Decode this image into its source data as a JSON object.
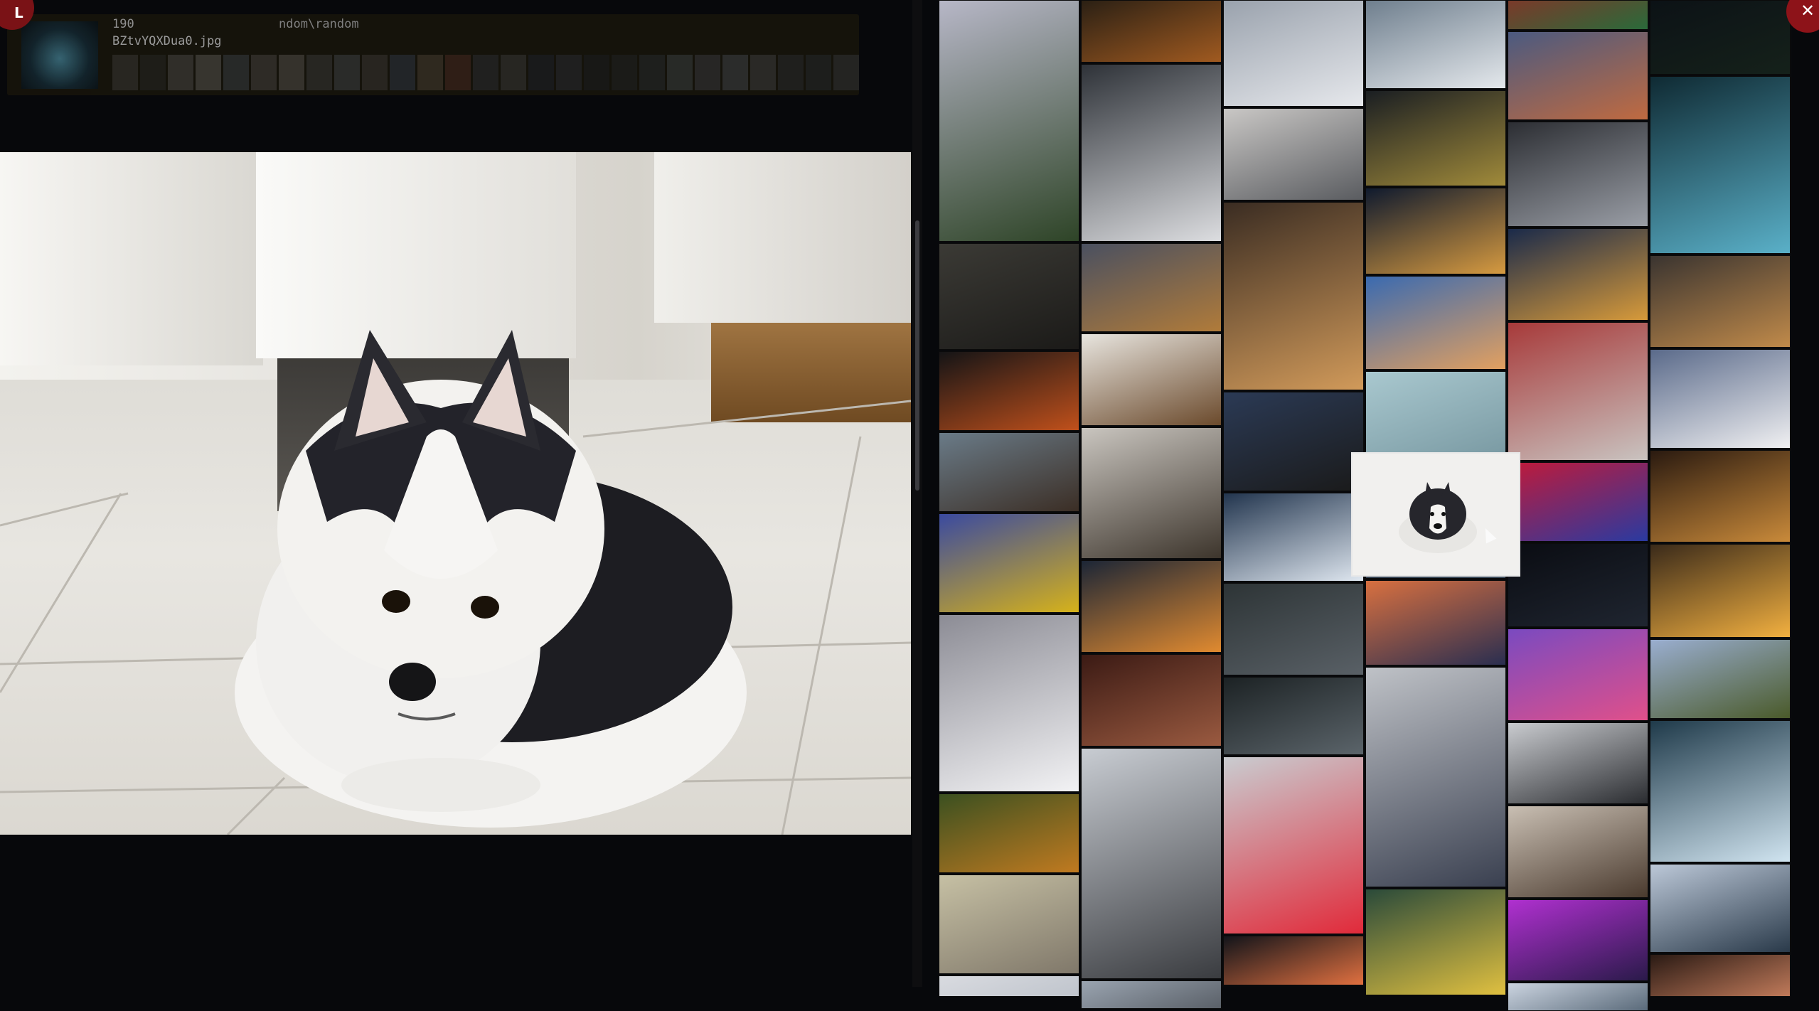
{
  "viewer": {
    "logo_letter": "L",
    "info": {
      "index": "190",
      "path": "ndom\\random",
      "filename": "BZtvYQXDua0.jpg"
    },
    "image_subject": "husky-dog-on-tile-floor"
  },
  "strip_colors": [
    "#3d3a36",
    "#2a2826",
    "#4c4a47",
    "#5b5753",
    "#3b3f46",
    "#484542",
    "#55524d",
    "#3a3a3a",
    "#404447",
    "#3c3935",
    "#323946",
    "#4a3f33",
    "#4a2a20",
    "#2e2f33",
    "#3a3a3a",
    "#1f232b",
    "#2b2d33",
    "#1d1f22",
    "#232426",
    "#2a2c30",
    "#3c4144",
    "#3a3b3f",
    "#44474a",
    "#3f3f42",
    "#2b2d30",
    "#262a2e",
    "#34363a"
  ],
  "gallery": {
    "columns": [
      {
        "tiles": [
          {
            "color_a": "#b7b7c7",
            "color_b": "#2e4427",
            "h": 340
          },
          {
            "color_a": "#3b3a35",
            "color_b": "#1b1a18",
            "h": 150
          },
          {
            "color_a": "#141416",
            "color_b": "#c0501b",
            "h": 112
          },
          {
            "color_a": "#6a7b88",
            "color_b": "#3b2e25",
            "h": 112
          },
          {
            "color_a": "#3a4aa0",
            "color_b": "#d6b21a",
            "h": 140
          },
          {
            "color_a": "#8c8c95",
            "color_b": "#f2f2f4",
            "h": 250
          },
          {
            "color_a": "#3b5020",
            "color_b": "#c07a20",
            "h": 112
          },
          {
            "color_a": "#c6c0a4",
            "color_b": "#80786a",
            "h": 140
          },
          {
            "color_a": "#d9dbe0",
            "color_b": "#bfc4cc",
            "h": 30
          }
        ]
      },
      {
        "tiles": [
          {
            "color_a": "#2b2014",
            "color_b": "#a05a20",
            "h": 88
          },
          {
            "color_a": "#2e3238",
            "color_b": "#dcdde0",
            "h": 250
          },
          {
            "color_a": "#4a5060",
            "color_b": "#b07b3a",
            "h": 125
          },
          {
            "color_a": "#e8e5df",
            "color_b": "#6b4a2c",
            "h": 130
          },
          {
            "color_a": "#c9c5bf",
            "color_b": "#3d352c",
            "h": 185
          },
          {
            "color_a": "#1c2636",
            "color_b": "#e08a30",
            "h": 130
          },
          {
            "color_a": "#3b1a14",
            "color_b": "#9a5a40",
            "h": 130
          },
          {
            "color_a": "#c8ccd2",
            "color_b": "#3a3c40",
            "h": 325
          },
          {
            "color_a": "#9aa4b0",
            "color_b": "#5a6068",
            "h": 40
          }
        ]
      },
      {
        "tiles": [
          {
            "color_a": "#9aa2ad",
            "color_b": "#e6e8ec",
            "h": 150
          },
          {
            "color_a": "#c9c7c5",
            "color_b": "#5a5c60",
            "h": 130
          },
          {
            "color_a": "#3a2c22",
            "color_b": "#d19a5a",
            "h": 265
          },
          {
            "color_a": "#2b3a55",
            "color_b": "#1a1a1a",
            "h": 140
          },
          {
            "color_a": "#22354e",
            "color_b": "#dfe7f0",
            "h": 125
          },
          {
            "color_a": "#2d3436",
            "color_b": "#596066",
            "h": 130
          },
          {
            "color_a": "#1c2224",
            "color_b": "#5b646a",
            "h": 110
          },
          {
            "color_a": "#c9ccd0",
            "color_b": "#e12a3a",
            "h": 250
          },
          {
            "color_a": "#12141a",
            "color_b": "#e07040",
            "h": 70
          }
        ]
      },
      {
        "tiles": [
          {
            "color_a": "#6f7f8e",
            "color_b": "#e4e8ec",
            "h": 125
          },
          {
            "color_a": "#1a1e22",
            "color_b": "#a08a3a",
            "h": 135
          },
          {
            "color_a": "#0f1a2e",
            "color_b": "#d69a40",
            "h": 122
          },
          {
            "color_a": "#3a6ab0",
            "color_b": "#e2a060",
            "h": 132
          },
          {
            "color_a": "#a9c8cf",
            "color_b": "#7a9aa3",
            "h": 120
          },
          {
            "color_a": "#1f2a3a",
            "color_b": "#3a4a5a",
            "h": 170
          },
          {
            "color_a": "#d87040",
            "color_b": "#2a2e50",
            "h": 120
          },
          {
            "color_a": "#bfc2c7",
            "color_b": "#3a4050",
            "h": 310
          },
          {
            "color_a": "#2a4a3a",
            "color_b": "#e0c040",
            "h": 150
          }
        ]
      },
      {
        "tiles": [
          {
            "color_a": "#7a3a2a",
            "color_b": "#2a6a3a",
            "h": 42
          },
          {
            "color_a": "#4b5a80",
            "color_b": "#c06a40",
            "h": 125
          },
          {
            "color_a": "#2c2e33",
            "color_b": "#9a9ea6",
            "h": 148
          },
          {
            "color_a": "#1a2a4a",
            "color_b": "#d79a3a",
            "h": 130
          },
          {
            "color_a": "#a73a3a",
            "color_b": "#c9c3c0",
            "h": 195
          },
          {
            "color_a": "#c01a3a",
            "color_b": "#2a3aa0",
            "h": 112
          },
          {
            "color_a": "#0a0c12",
            "color_b": "#1f2530",
            "h": 118
          },
          {
            "color_a": "#7a4ac0",
            "color_b": "#e0508a",
            "h": 130
          },
          {
            "color_a": "#c9cbcf",
            "color_b": "#2a2c30",
            "h": 115
          },
          {
            "color_a": "#c9bfb3",
            "color_b": "#4a3a2e",
            "h": 130
          },
          {
            "color_a": "#b030d0",
            "color_b": "#2a1a4a",
            "h": 115
          },
          {
            "color_a": "#cbd4e0",
            "color_b": "#5a6a7a",
            "h": 40
          }
        ]
      },
      {
        "tiles": [
          {
            "color_a": "#0c1216",
            "color_b": "#15211a",
            "h": 105
          },
          {
            "color_a": "#0f2a33",
            "color_b": "#5ab0c8",
            "h": 250
          },
          {
            "color_a": "#3a3430",
            "color_b": "#c08a4a",
            "h": 130
          },
          {
            "color_a": "#5a6a8a",
            "color_b": "#f0f0f2",
            "h": 140
          },
          {
            "color_a": "#2a1a10",
            "color_b": "#c98a3a",
            "h": 130
          },
          {
            "color_a": "#3a2a1a",
            "color_b": "#f2b040",
            "h": 132
          },
          {
            "color_a": "#9aaed0",
            "color_b": "#4a5a2a",
            "h": 112
          },
          {
            "color_a": "#1f3a4a",
            "color_b": "#d0e4f0",
            "h": 200
          },
          {
            "color_a": "#bcc8d8",
            "color_b": "#2a3a4a",
            "h": 125
          },
          {
            "color_a": "#2a1a14",
            "color_b": "#c07a5a",
            "h": 60
          }
        ]
      }
    ]
  },
  "close_button": {
    "symbol": "✕"
  }
}
